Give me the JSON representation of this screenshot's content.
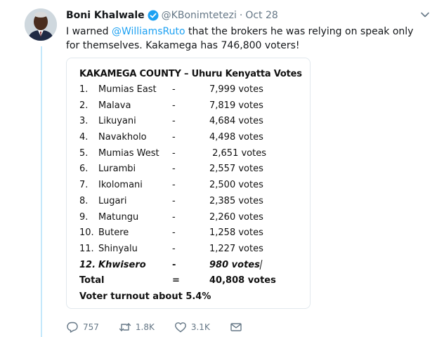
{
  "tweet": {
    "author_name": "Boni Khalwale",
    "handle": "@KBonimtetezi",
    "separator": "·",
    "timestamp": "Oct 28",
    "text_part1": "I warned ",
    "mention": "@WilliamsRuto",
    "text_part2": " that the brokers he was relying on speak only for themselves. Kakamega has 746,800 voters!"
  },
  "card": {
    "title": "KAKAMEGA COUNTY – Uhuru Kenyatta Votes",
    "rows": [
      {
        "num": "1.",
        "place": "Mumias East",
        "dash": "-",
        "votes": "7,999 votes"
      },
      {
        "num": "2.",
        "place": "Malava",
        "dash": "-",
        "votes": "7,819 votes"
      },
      {
        "num": "3.",
        "place": "Likuyani",
        "dash": "-",
        "votes": "4,684 votes"
      },
      {
        "num": "4.",
        "place": "Navakholo",
        "dash": "-",
        "votes": "4,498 votes"
      },
      {
        "num": "5.",
        "place": "Mumias West",
        "dash": "-",
        "votes": " 2,651 votes"
      },
      {
        "num": "6.",
        "place": "Lurambi",
        "dash": "-",
        "votes": "2,557 votes"
      },
      {
        "num": "7.",
        "place": "Ikolomani",
        "dash": "-",
        "votes": "2,500 votes"
      },
      {
        "num": "8.",
        "place": "Lugari",
        "dash": "-",
        "votes": "2,385 votes"
      },
      {
        "num": "9.",
        "place": "Matungu",
        "dash": "-",
        "votes": "2,260 votes"
      },
      {
        "num": "10.",
        "place": "Butere",
        "dash": "-",
        "votes": "1,258 votes"
      },
      {
        "num": "11.",
        "place": "Shinyalu",
        "dash": "-",
        "votes": "1,227 votes"
      },
      {
        "num": "12.",
        "place": "Khwisero",
        "dash": "-",
        "votes": "980 votes"
      }
    ],
    "total_label": "Total",
    "total_sign": "=",
    "total_votes": "40,808 votes",
    "turnout": "Voter turnout about 5.4%"
  },
  "actions": {
    "reply_count": "757",
    "retweet_count": "1.8K",
    "like_count": "3.1K"
  },
  "icons": {
    "verified": "verified-badge-icon",
    "caret": "chevron-down-icon",
    "reply": "reply-icon",
    "retweet": "retweet-icon",
    "like": "heart-icon",
    "dm": "envelope-icon"
  },
  "colors": {
    "link": "#1da1f2",
    "muted": "#657786",
    "thread_line": "#c4e8fb"
  }
}
